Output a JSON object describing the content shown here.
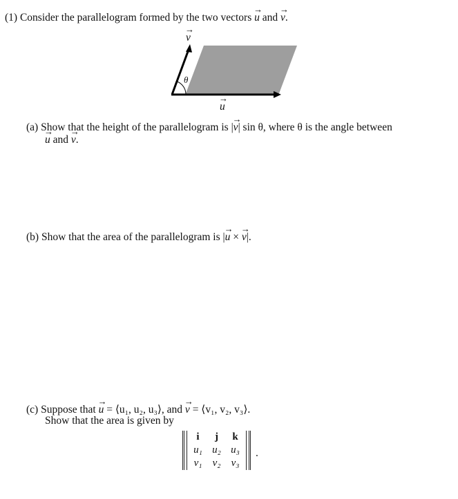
{
  "problem": {
    "number": "(1)",
    "intro_text": "Consider the parallelogram formed by the two vectors",
    "and_text": "and",
    "period": "."
  },
  "figure": {
    "vector_v_label": "v",
    "vector_u_label": "u",
    "angle_label": "θ",
    "fill_color": "#9e9e9e",
    "arrow_color": "#000000"
  },
  "parts": {
    "a": {
      "label": "(a)",
      "text_before": "Show that the height of the parallelogram is |",
      "vec": "v",
      "text_after": "| sin θ, where θ is the angle between",
      "line2_u": "u",
      "line2_and": "and",
      "line2_v": "v",
      "line2_end": "."
    },
    "b": {
      "label": "(b)",
      "text_before": "Show that the area of the parallelogram is |",
      "vec_u": "u",
      "times": "×",
      "vec_v": "v",
      "text_after": "|."
    },
    "c": {
      "label": "(c)",
      "text_before": "Suppose that",
      "vec_u": "u",
      "eq_u": "= ⟨u₁, u₂, u₃⟩, and",
      "vec_v": "v",
      "eq_v": "= ⟨v₁, v₂, v₃⟩.",
      "line2": "Show that the area is given by",
      "matrix": [
        [
          "i",
          "j",
          "k"
        ],
        [
          "u₁",
          "u₂",
          "u₃"
        ],
        [
          "v₁",
          "v₂",
          "v₃"
        ]
      ],
      "matrix_end": "."
    }
  }
}
